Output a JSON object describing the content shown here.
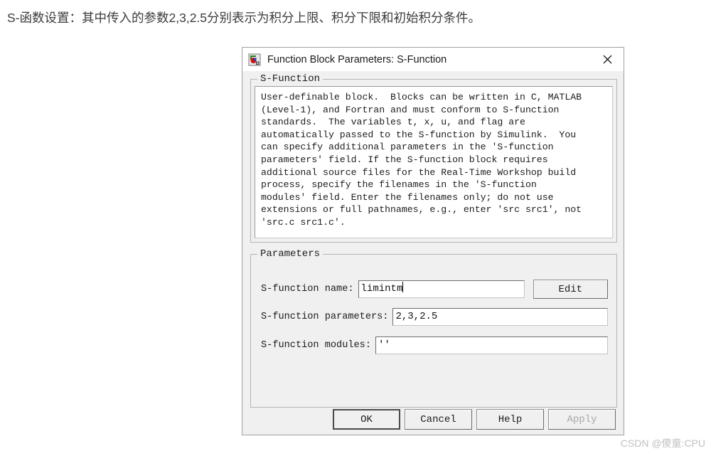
{
  "page": {
    "caption": "S-函数设置：其中传入的参数2,3,2.5分别表示为积分上限、积分下限和初始积分条件。",
    "watermark": "CSDN @傻童:CPU"
  },
  "dialog": {
    "title": "Function Block Parameters: S-Function",
    "icon": "simulink-block-icon",
    "close_label": "✕",
    "sfunction_group": {
      "legend": "S-Function",
      "description": "User-definable block.  Blocks can be written in C, MATLAB\n(Level-1), and Fortran and must conform to S-function\nstandards.  The variables t, x, u, and flag are\nautomatically passed to the S-function by Simulink.  You\ncan specify additional parameters in the 'S-function\nparameters' field. If the S-function block requires\nadditional source files for the Real-Time Workshop build\nprocess, specify the filenames in the 'S-function\nmodules' field. Enter the filenames only; do not use\nextensions or full pathnames, e.g., enter 'src src1', not\n'src.c src1.c'."
    },
    "parameters_group": {
      "legend": "Parameters",
      "fields": [
        {
          "label": "S-function name:",
          "value": "limintm",
          "placeholder": ""
        },
        {
          "label": "S-function parameters:",
          "value": "2,3,2.5",
          "placeholder": ""
        },
        {
          "label": "S-function modules:",
          "value": "''",
          "placeholder": ""
        }
      ],
      "edit_button": "Edit"
    },
    "buttons": [
      {
        "label": "OK",
        "state": "default"
      },
      {
        "label": "Cancel",
        "state": "normal"
      },
      {
        "label": "Help",
        "state": "normal"
      },
      {
        "label": "Apply",
        "state": "disabled"
      }
    ]
  },
  "colors": {
    "dialog_face": "#f0f0f0",
    "field_bg": "#ffffff",
    "text": "#1c1c1c",
    "disabled_text": "#a8a8a8",
    "watermark": "#c2c2c2"
  }
}
